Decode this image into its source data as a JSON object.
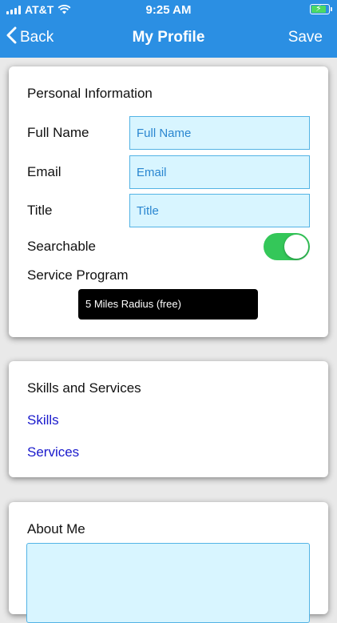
{
  "status_bar": {
    "carrier": "AT&T",
    "time": "9:25 AM",
    "battery_level": 0.9,
    "battery_color": "#4cd964"
  },
  "nav": {
    "back_label": "Back",
    "title": "My Profile",
    "save_label": "Save",
    "background": "#2b8fe3"
  },
  "personal": {
    "title": "Personal Information",
    "full_name_label": "Full Name",
    "full_name_placeholder": "Full Name",
    "email_label": "Email",
    "email_placeholder": "Email",
    "title_label": "Title",
    "title_placeholder": "Title",
    "searchable_label": "Searchable",
    "searchable_on": true,
    "service_program_label": "Service Program",
    "service_program_value": "5 Miles Radius (free)"
  },
  "skills": {
    "title": "Skills and Services",
    "skills_link": "Skills",
    "services_link": "Services"
  },
  "about": {
    "title": "About Me"
  }
}
